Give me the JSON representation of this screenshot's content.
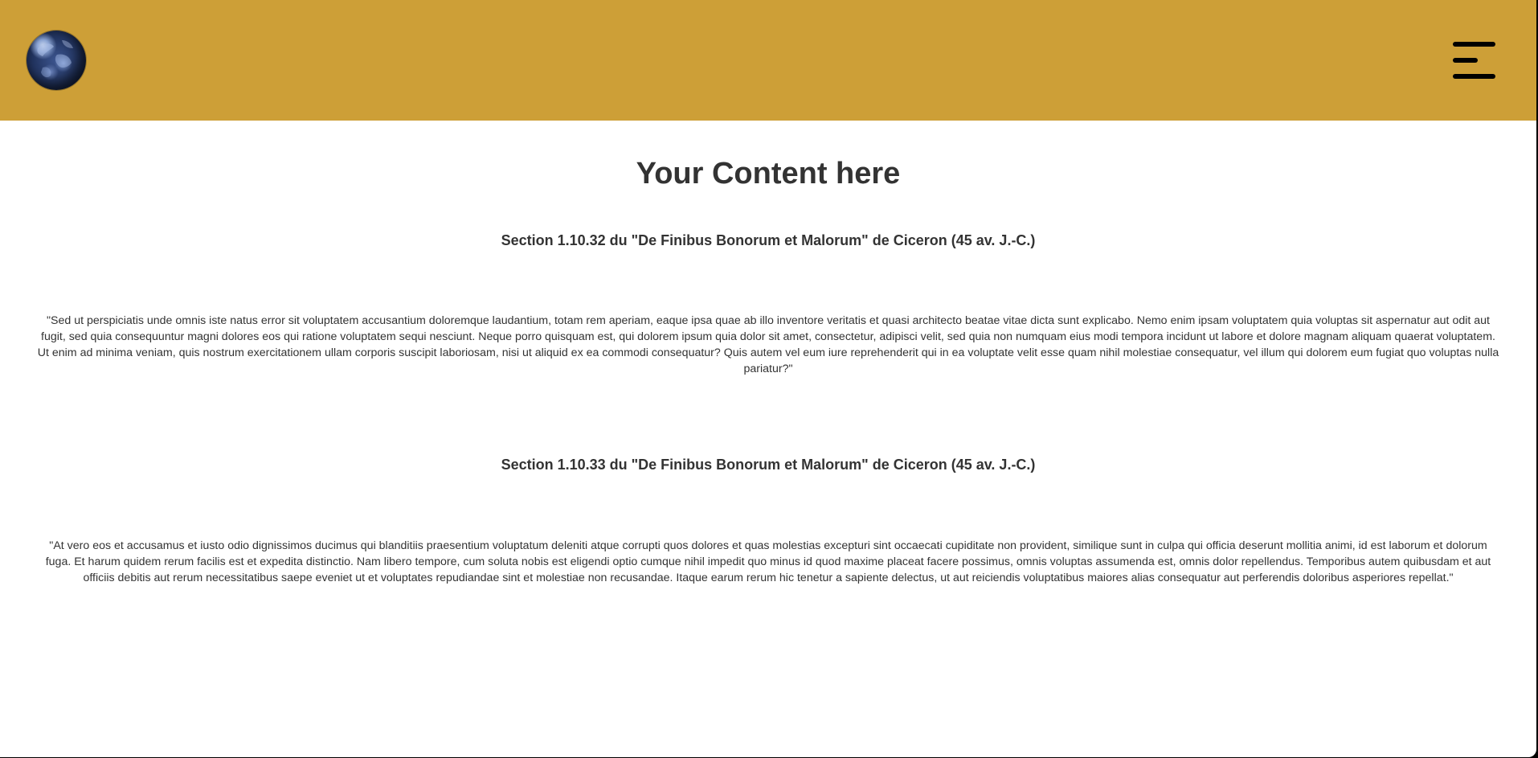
{
  "header": {
    "background_color": "#cd9f37",
    "logo_icon": "earth-globe-icon",
    "menu_icon": "hamburger-menu-icon"
  },
  "main": {
    "title": "Your Content here",
    "sections": [
      {
        "heading": "Section 1.10.32 du \"De Finibus Bonorum et Malorum\" de Ciceron (45 av. J.-C.)",
        "text": "\"Sed ut perspiciatis unde omnis iste natus error sit voluptatem accusantium doloremque laudantium, totam rem aperiam, eaque ipsa quae ab illo inventore veritatis et quasi architecto beatae vitae dicta sunt explicabo. Nemo enim ipsam voluptatem quia voluptas sit aspernatur aut odit aut fugit, sed quia consequuntur magni dolores eos qui ratione voluptatem sequi nesciunt. Neque porro quisquam est, qui dolorem ipsum quia dolor sit amet, consectetur, adipisci velit, sed quia non numquam eius modi tempora incidunt ut labore et dolore magnam aliquam quaerat voluptatem. Ut enim ad minima veniam, quis nostrum exercitationem ullam corporis suscipit laboriosam, nisi ut aliquid ex ea commodi consequatur? Quis autem vel eum iure reprehenderit qui in ea voluptate velit esse quam nihil molestiae consequatur, vel illum qui dolorem eum fugiat quo voluptas nulla pariatur?\""
      },
      {
        "heading": "Section 1.10.33 du \"De Finibus Bonorum et Malorum\" de Ciceron (45 av. J.-C.)",
        "text": "\"At vero eos et accusamus et iusto odio dignissimos ducimus qui blanditiis praesentium voluptatum deleniti atque corrupti quos dolores et quas molestias excepturi sint occaecati cupiditate non provident, similique sunt in culpa qui officia deserunt mollitia animi, id est laborum et dolorum fuga. Et harum quidem rerum facilis est et expedita distinctio. Nam libero tempore, cum soluta nobis est eligendi optio cumque nihil impedit quo minus id quod maxime placeat facere possimus, omnis voluptas assumenda est, omnis dolor repellendus. Temporibus autem quibusdam et aut officiis debitis aut rerum necessitatibus saepe eveniet ut et voluptates repudiandae sint et molestiae non recusandae. Itaque earum rerum hic tenetur a sapiente delectus, ut aut reiciendis voluptatibus maiores alias consequatur aut perferendis doloribus asperiores repellat.\""
      }
    ]
  }
}
